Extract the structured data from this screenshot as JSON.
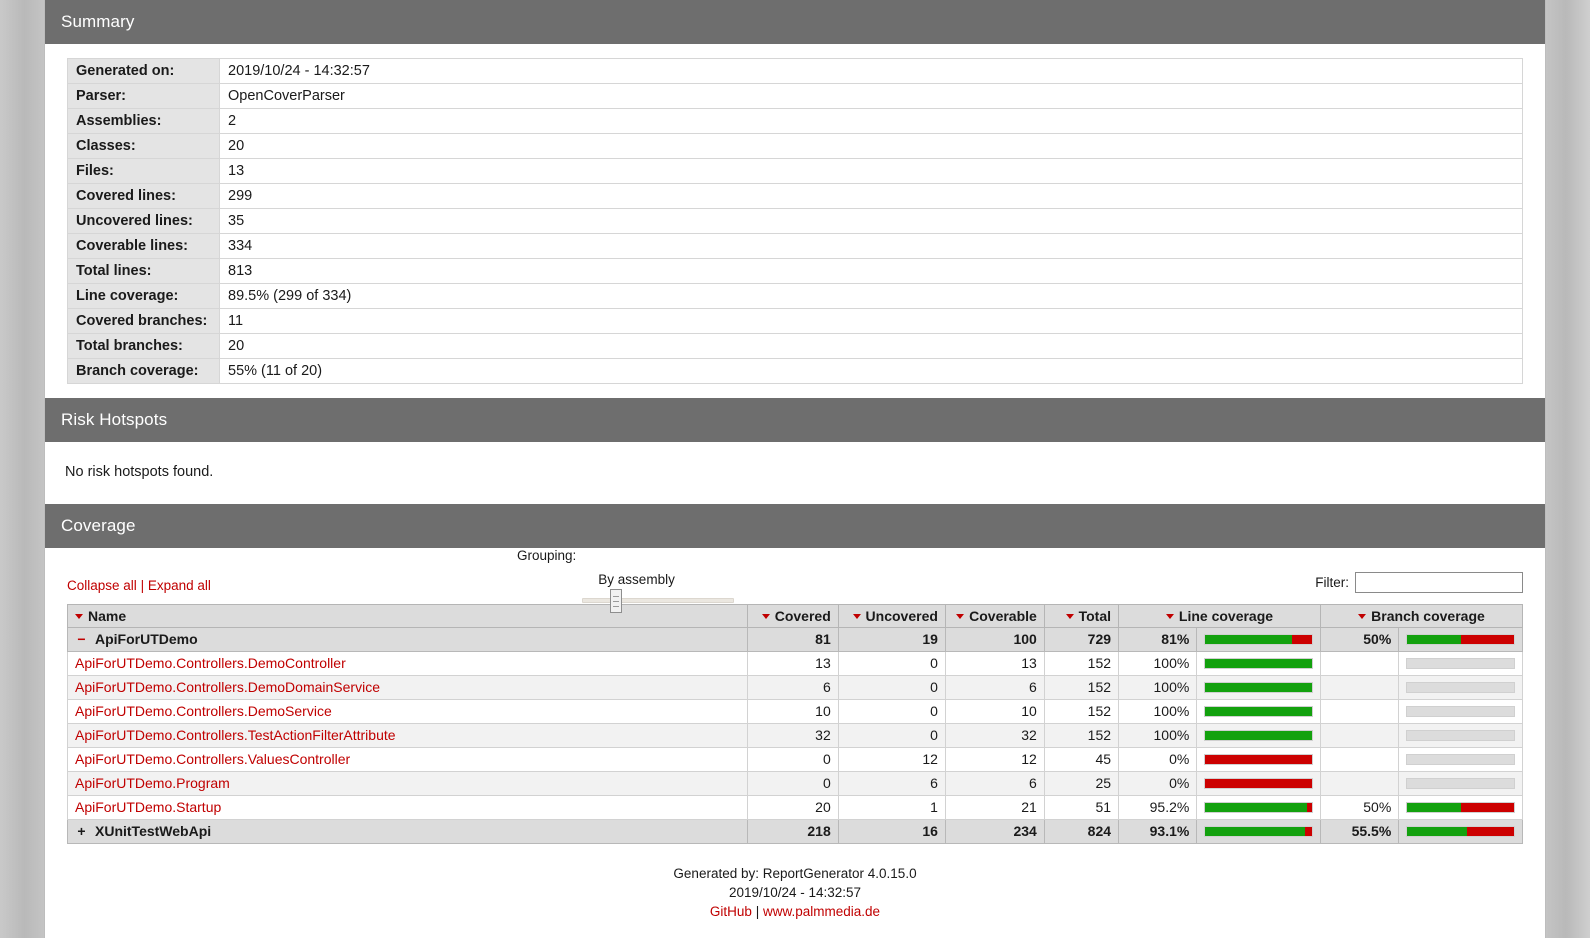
{
  "sections": {
    "summary_title": "Summary",
    "risk_title": "Risk Hotspots",
    "coverage_title": "Coverage"
  },
  "summary": {
    "rows": [
      {
        "key": "Generated on:",
        "value": "2019/10/24 - 14:32:57"
      },
      {
        "key": "Parser:",
        "value": "OpenCoverParser"
      },
      {
        "key": "Assemblies:",
        "value": "2"
      },
      {
        "key": "Classes:",
        "value": "20"
      },
      {
        "key": "Files:",
        "value": "13"
      },
      {
        "key": "Covered lines:",
        "value": "299"
      },
      {
        "key": "Uncovered lines:",
        "value": "35"
      },
      {
        "key": "Coverable lines:",
        "value": "334"
      },
      {
        "key": "Total lines:",
        "value": "813"
      },
      {
        "key": "Line coverage:",
        "value": "89.5% (299 of 334)"
      },
      {
        "key": "Covered branches:",
        "value": "11"
      },
      {
        "key": "Total branches:",
        "value": "20"
      },
      {
        "key": "Branch coverage:",
        "value": "55% (11 of 20)"
      }
    ]
  },
  "risk_hotspots": {
    "message": "No risk hotspots found."
  },
  "coverage": {
    "collapse_all": "Collapse all",
    "link_separator": "|",
    "expand_all": "Expand all",
    "grouping_label": "Grouping:",
    "grouping_value": "By assembly",
    "grouping_slider_percent": 22,
    "filter_label": "Filter:",
    "filter_value": "",
    "filter_placeholder": "",
    "columns": [
      "Name",
      "Covered",
      "Uncovered",
      "Coverable",
      "Total",
      "Line coverage",
      "Branch coverage"
    ],
    "rows": [
      {
        "type": "group",
        "toggle": "−",
        "name": "ApiForUTDemo",
        "covered": "81",
        "uncovered": "19",
        "coverable": "100",
        "total": "729",
        "line_pct": "81%",
        "line_value": 81,
        "branch_pct": "50%",
        "branch_value": 50,
        "branch_has_bar": true
      },
      {
        "type": "class",
        "name": "ApiForUTDemo.Controllers.DemoController",
        "covered": "13",
        "uncovered": "0",
        "coverable": "13",
        "total": "152",
        "line_pct": "100%",
        "line_value": 100,
        "branch_pct": "",
        "branch_value": 0,
        "branch_has_bar": false
      },
      {
        "type": "class",
        "name": "ApiForUTDemo.Controllers.DemoDomainService",
        "covered": "6",
        "uncovered": "0",
        "coverable": "6",
        "total": "152",
        "line_pct": "100%",
        "line_value": 100,
        "branch_pct": "",
        "branch_value": 0,
        "branch_has_bar": false
      },
      {
        "type": "class",
        "name": "ApiForUTDemo.Controllers.DemoService",
        "covered": "10",
        "uncovered": "0",
        "coverable": "10",
        "total": "152",
        "line_pct": "100%",
        "line_value": 100,
        "branch_pct": "",
        "branch_value": 0,
        "branch_has_bar": false
      },
      {
        "type": "class",
        "name": "ApiForUTDemo.Controllers.TestActionFilterAttribute",
        "covered": "32",
        "uncovered": "0",
        "coverable": "32",
        "total": "152",
        "line_pct": "100%",
        "line_value": 100,
        "branch_pct": "",
        "branch_value": 0,
        "branch_has_bar": false
      },
      {
        "type": "class",
        "name": "ApiForUTDemo.Controllers.ValuesController",
        "covered": "0",
        "uncovered": "12",
        "coverable": "12",
        "total": "45",
        "line_pct": "0%",
        "line_value": 0,
        "branch_pct": "",
        "branch_value": 0,
        "branch_has_bar": false
      },
      {
        "type": "class",
        "name": "ApiForUTDemo.Program",
        "covered": "0",
        "uncovered": "6",
        "coverable": "6",
        "total": "25",
        "line_pct": "0%",
        "line_value": 0,
        "branch_pct": "",
        "branch_value": 0,
        "branch_has_bar": false
      },
      {
        "type": "class",
        "name": "ApiForUTDemo.Startup",
        "covered": "20",
        "uncovered": "1",
        "coverable": "21",
        "total": "51",
        "line_pct": "95.2%",
        "line_value": 95.2,
        "branch_pct": "50%",
        "branch_value": 50,
        "branch_has_bar": true
      },
      {
        "type": "group",
        "toggle": "+",
        "name": "XUnitTestWebApi",
        "covered": "218",
        "uncovered": "16",
        "coverable": "234",
        "total": "824",
        "line_pct": "93.1%",
        "line_value": 93.1,
        "branch_pct": "55.5%",
        "branch_value": 55.5,
        "branch_has_bar": true
      }
    ]
  },
  "footer": {
    "generated_by": "Generated by: ReportGenerator 4.0.15.0",
    "timestamp": "2019/10/24 - 14:32:57",
    "github": "GitHub",
    "separator": "|",
    "website": "www.palmmedia.de"
  },
  "colors": {
    "accent_red": "#c00000",
    "covered_green": "#13a10e",
    "uncovered_red": "#cc0000",
    "bar_empty": "#dcdcdc",
    "header_bar": "#6e6e6e"
  }
}
